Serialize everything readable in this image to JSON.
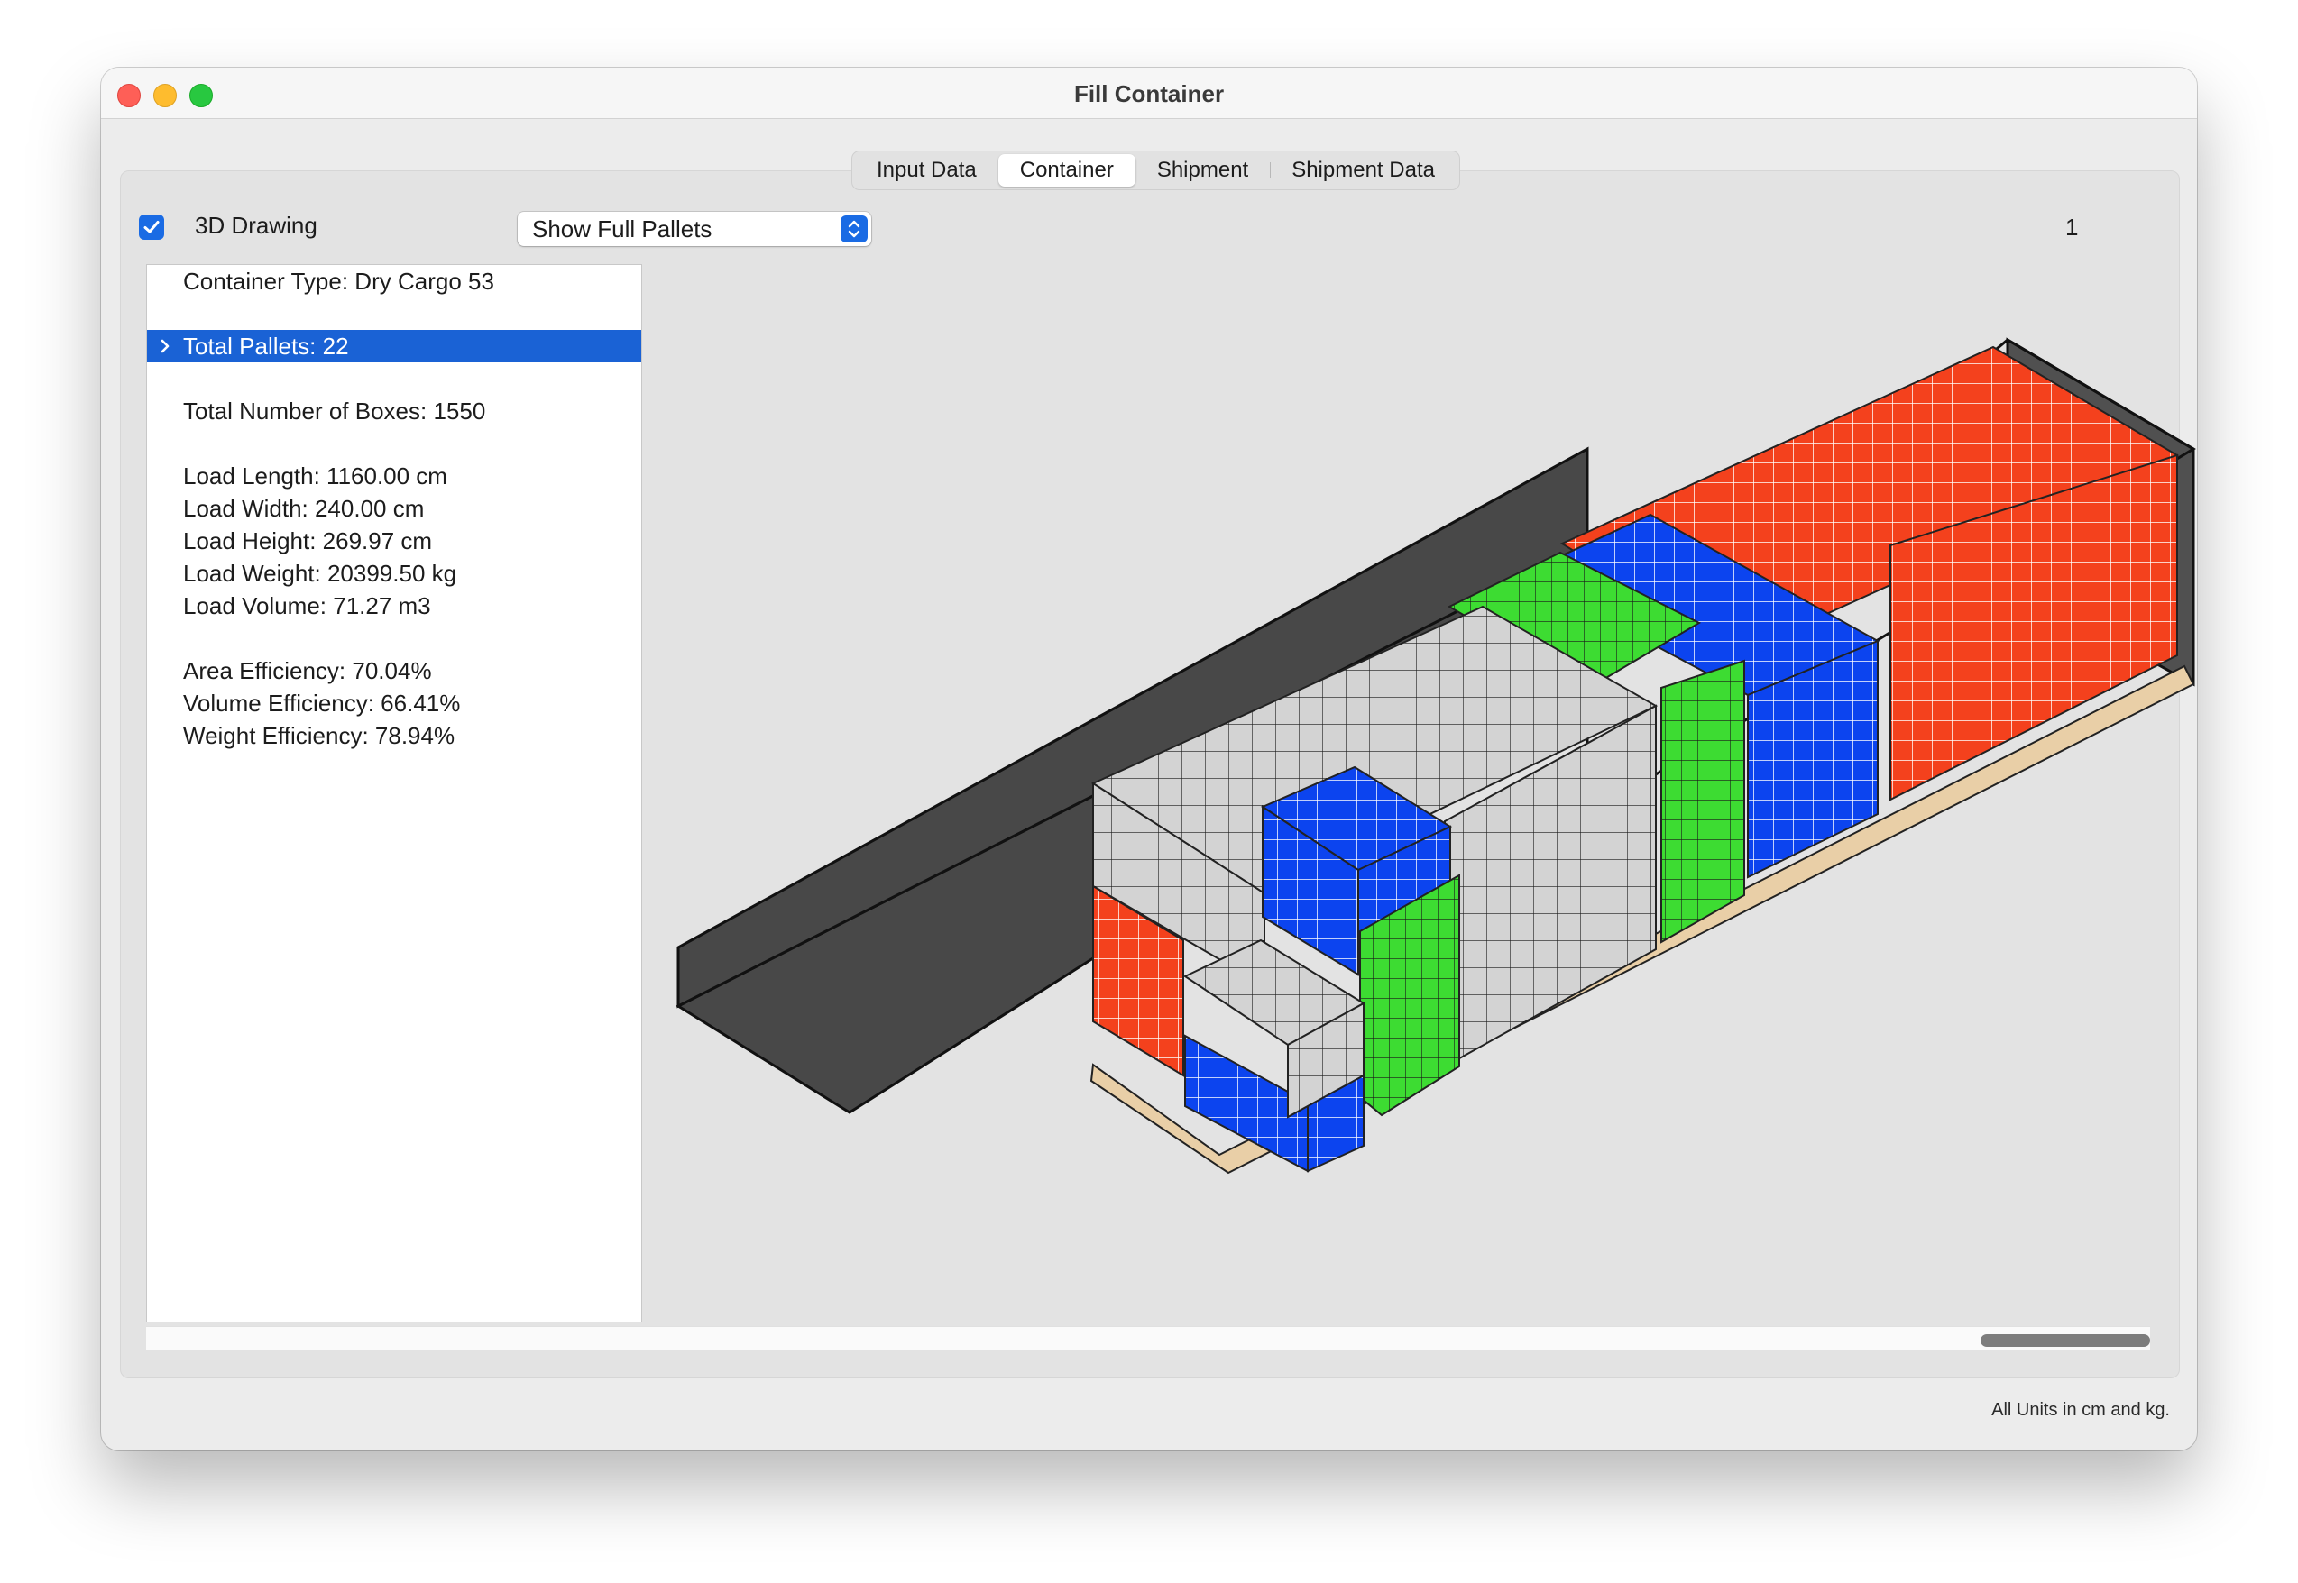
{
  "window": {
    "title": "Fill Container"
  },
  "tabs": [
    {
      "label": "Input Data",
      "active": false
    },
    {
      "label": "Container",
      "active": true
    },
    {
      "label": "Shipment",
      "active": false
    },
    {
      "label": "Shipment Data",
      "active": false
    }
  ],
  "toolbar": {
    "checkbox_label": "3D Drawing",
    "checkbox_checked": true,
    "popup_value": "Show Full Pallets",
    "page_number": "1"
  },
  "info": {
    "container_type": "Container Type: Dry Cargo 53",
    "total_pallets": "Total Pallets: 22",
    "total_boxes": "Total Number of Boxes: 1550",
    "load_length": "Load Length: 1160.00 cm",
    "load_width": "Load Width: 240.00 cm",
    "load_height": "Load Height: 269.97 cm",
    "load_weight": "Load Weight: 20399.50 kg",
    "load_volume": "Load Volume: 71.27 m3",
    "area_efficiency": "Area Efficiency: 70.04%",
    "volume_efficiency": "Volume Efficiency: 66.41%",
    "weight_efficiency": "Weight Efficiency: 78.94%"
  },
  "footer": {
    "units_note": "All Units in cm and kg."
  },
  "colors": {
    "red": "#f4411d",
    "blue": "#0c44ef",
    "green": "#3ddc32",
    "gray": "#d3d3d3",
    "container": "#484848",
    "accent": "#1a6be4",
    "selection": "#1a62d5"
  },
  "icons": {
    "checkbox": "checkmark-icon",
    "popup": "up-down-chevron-icon",
    "disclosure": "chevron-right-icon"
  }
}
